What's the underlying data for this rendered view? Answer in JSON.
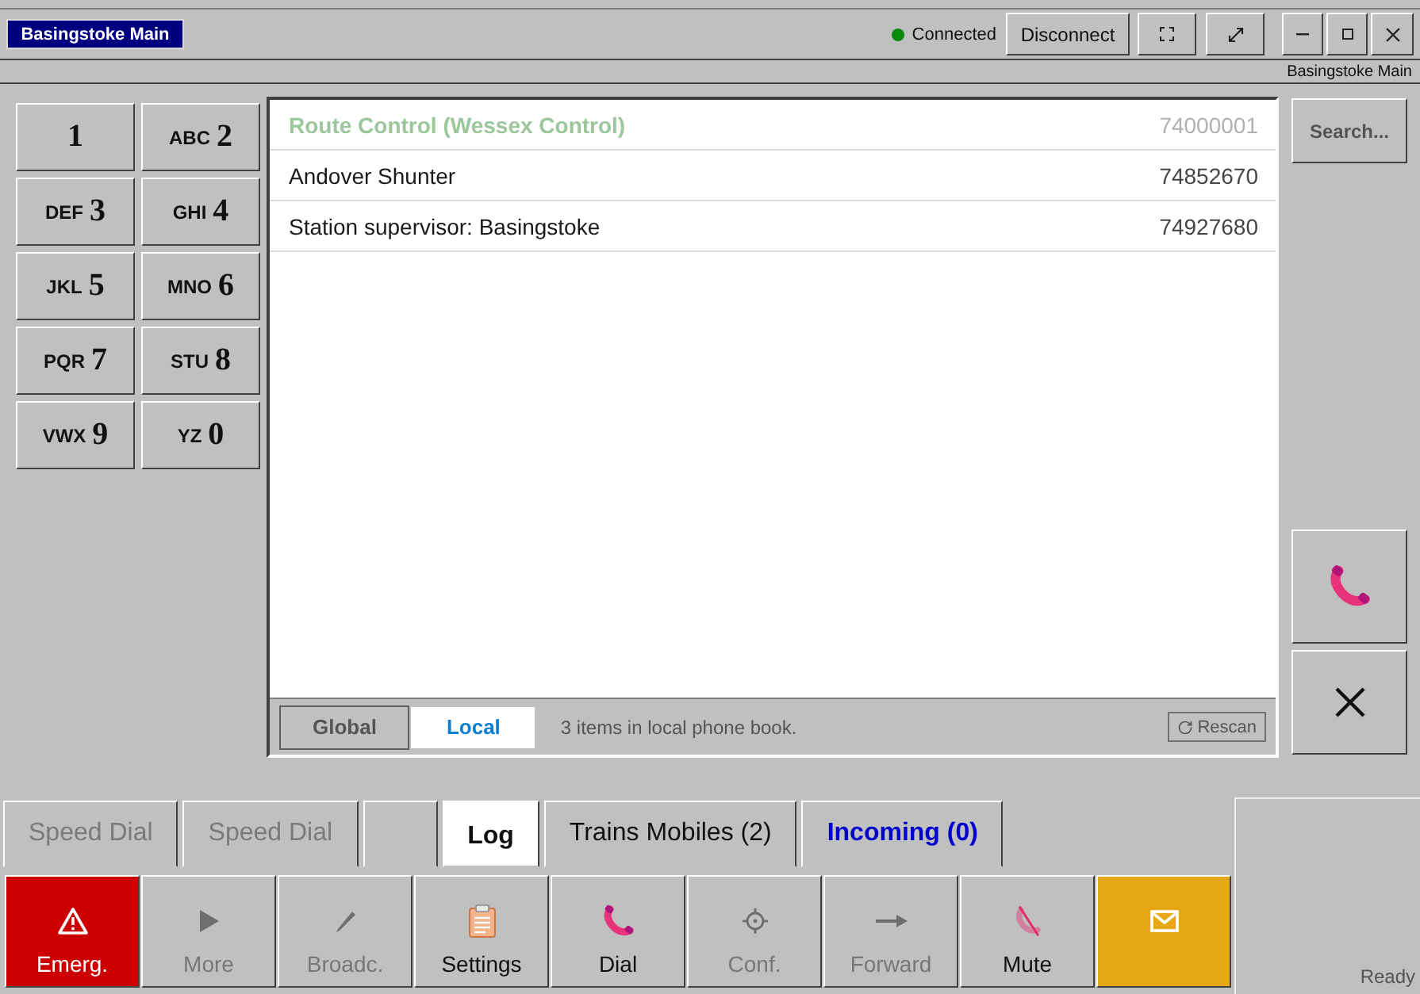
{
  "top_bar": {
    "badge": "Basingstoke Main",
    "connection": {
      "label": "Connected",
      "connected": true
    },
    "disconnect": "Disconnect"
  },
  "location": "Basingstoke Main",
  "keypad": [
    {
      "digit": "1"
    },
    {
      "letters": "ABC",
      "digit": "2"
    },
    {
      "letters": "DEF",
      "digit": "3"
    },
    {
      "letters": "GHI",
      "digit": "4"
    },
    {
      "letters": "JKL",
      "digit": "5"
    },
    {
      "letters": "MNO",
      "digit": "6"
    },
    {
      "letters": "PQR",
      "digit": "7"
    },
    {
      "letters": "STU",
      "digit": "8"
    },
    {
      "letters": "VWX",
      "digit": "9"
    },
    {
      "letters": "YZ",
      "digit": "0"
    }
  ],
  "phone_book": {
    "entries": [
      {
        "name": "Route Control (Wessex Control)",
        "number": "74000001",
        "disabled": true
      },
      {
        "name": "Andover Shunter",
        "number": "74852670",
        "disabled": false
      },
      {
        "name": "Station supervisor: Basingstoke",
        "number": "74927680",
        "disabled": false
      }
    ],
    "scopes": [
      {
        "label": "Global",
        "selected": false
      },
      {
        "label": "Local",
        "selected": true
      }
    ],
    "summary": "3 items in local phone book.",
    "rescan": "Rescan"
  },
  "search_button": "Search...",
  "tabs": [
    {
      "kind": "label",
      "label": "Speed Dial",
      "selected": false,
      "disabled": true,
      "highlighted": false
    },
    {
      "kind": "label",
      "label": "Speed Dial",
      "selected": false,
      "disabled": true,
      "highlighted": false
    },
    {
      "kind": "blank",
      "selected": false
    },
    {
      "kind": "label",
      "label": "Log",
      "selected": true,
      "disabled": false,
      "highlighted": false
    },
    {
      "kind": "label",
      "label": "Trains Mobiles (2)",
      "selected": false,
      "disabled": false,
      "highlighted": false
    },
    {
      "kind": "label",
      "label": "Incoming (0)",
      "selected": false,
      "disabled": false,
      "highlighted": true
    }
  ],
  "actions": [
    {
      "kind": "emergency",
      "label": "Emerg.",
      "disabled": false
    },
    {
      "kind": "more",
      "label": "More",
      "disabled": true
    },
    {
      "kind": "broadcast",
      "label": "Broadc.",
      "disabled": true
    },
    {
      "kind": "settings",
      "label": "Settings",
      "disabled": false
    },
    {
      "kind": "dial",
      "label": "Dial",
      "disabled": false
    },
    {
      "kind": "conference",
      "label": "Conf.",
      "disabled": true
    },
    {
      "kind": "forward",
      "label": "Forward",
      "disabled": true
    },
    {
      "kind": "mute",
      "label": "Mute",
      "disabled": false
    },
    {
      "kind": "message",
      "disabled": false
    }
  ],
  "status_bar": {
    "text": "Ready"
  }
}
